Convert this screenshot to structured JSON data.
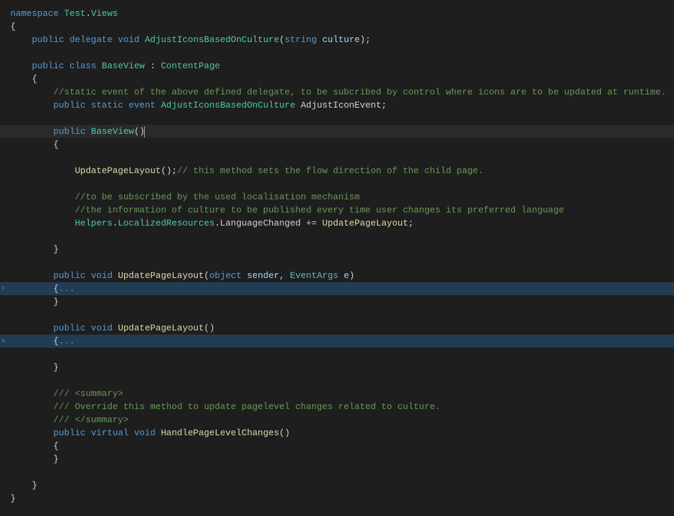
{
  "code": {
    "lines": [
      {
        "indent": 0,
        "segs": [
          [
            "kw",
            "namespace"
          ],
          [
            "str",
            " "
          ],
          [
            "cls",
            "Test"
          ],
          [
            "punc",
            "."
          ],
          [
            "cls",
            "Views"
          ]
        ]
      },
      {
        "indent": 0,
        "segs": [
          [
            "punc",
            "{"
          ]
        ]
      },
      {
        "indent": 1,
        "segs": [
          [
            "kw",
            "public"
          ],
          [
            "str",
            " "
          ],
          [
            "kw",
            "delegate"
          ],
          [
            "str",
            " "
          ],
          [
            "kw",
            "void"
          ],
          [
            "str",
            " "
          ],
          [
            "cls",
            "AdjustIconsBasedOnCulture"
          ],
          [
            "punc",
            "("
          ],
          [
            "kw",
            "string"
          ],
          [
            "str",
            " "
          ],
          [
            "param",
            "culture"
          ],
          [
            "punc",
            ");"
          ]
        ]
      },
      {
        "indent": 0,
        "segs": []
      },
      {
        "indent": 1,
        "segs": [
          [
            "kw",
            "public"
          ],
          [
            "str",
            " "
          ],
          [
            "kw",
            "class"
          ],
          [
            "str",
            " "
          ],
          [
            "cls",
            "BaseView"
          ],
          [
            "str",
            " : "
          ],
          [
            "cls",
            "ContentPage"
          ]
        ]
      },
      {
        "indent": 1,
        "segs": [
          [
            "punc",
            "{"
          ]
        ]
      },
      {
        "indent": 2,
        "segs": [
          [
            "cmt",
            "//static event of the above defined delegate, to be subcribed by control where icons are to be updated at runtime."
          ]
        ]
      },
      {
        "indent": 2,
        "segs": [
          [
            "kw",
            "public"
          ],
          [
            "str",
            " "
          ],
          [
            "kw",
            "static"
          ],
          [
            "str",
            " "
          ],
          [
            "kw",
            "event"
          ],
          [
            "str",
            " "
          ],
          [
            "cls",
            "AdjustIconsBasedOnCulture"
          ],
          [
            "str",
            " AdjustIconEvent;"
          ]
        ]
      },
      {
        "indent": 0,
        "segs": []
      },
      {
        "indent": 2,
        "current": true,
        "segs": [
          [
            "kw",
            "public"
          ],
          [
            "str",
            " "
          ],
          [
            "cls",
            "BaseView"
          ],
          [
            "punc",
            "()"
          ],
          [
            "cursor",
            ""
          ]
        ]
      },
      {
        "indent": 2,
        "segs": [
          [
            "punc",
            "{"
          ]
        ]
      },
      {
        "indent": 0,
        "segs": []
      },
      {
        "indent": 3,
        "segs": [
          [
            "mtd",
            "UpdatePageLayout"
          ],
          [
            "punc",
            "();"
          ],
          [
            "cmt",
            "// this method sets the flow direction of the child page."
          ]
        ]
      },
      {
        "indent": 0,
        "segs": []
      },
      {
        "indent": 3,
        "segs": [
          [
            "cmt",
            "//to be subscribed by the used localisation mechanism"
          ]
        ]
      },
      {
        "indent": 3,
        "segs": [
          [
            "cmt",
            "//the information of culture to be published every time user changes its preferred language"
          ]
        ]
      },
      {
        "indent": 3,
        "segs": [
          [
            "cls",
            "Helpers"
          ],
          [
            "punc",
            "."
          ],
          [
            "cls",
            "LocalizedResources"
          ],
          [
            "punc",
            "."
          ],
          [
            "str",
            "LanguageChanged "
          ],
          [
            "punc",
            "+="
          ],
          [
            "str",
            " "
          ],
          [
            "mtd",
            "UpdatePageLayout"
          ],
          [
            "punc",
            ";"
          ]
        ]
      },
      {
        "indent": 0,
        "segs": []
      },
      {
        "indent": 2,
        "segs": [
          [
            "punc",
            "}"
          ]
        ]
      },
      {
        "indent": 0,
        "segs": []
      },
      {
        "indent": 2,
        "segs": [
          [
            "kw",
            "public"
          ],
          [
            "str",
            " "
          ],
          [
            "kw",
            "void"
          ],
          [
            "str",
            " "
          ],
          [
            "mtd",
            "UpdatePageLayout"
          ],
          [
            "punc",
            "("
          ],
          [
            "kw",
            "object"
          ],
          [
            "str",
            " "
          ],
          [
            "param",
            "sender"
          ],
          [
            "punc",
            ", "
          ],
          [
            "cls",
            "EventArgs"
          ],
          [
            "str",
            " "
          ],
          [
            "param",
            "e"
          ],
          [
            "punc",
            ")"
          ]
        ]
      },
      {
        "indent": 2,
        "fold": true,
        "highlight": true,
        "segs": [
          [
            "punc",
            "{"
          ],
          [
            "fold-dots",
            "..."
          ]
        ]
      },
      {
        "indent": 2,
        "segs": [
          [
            "punc",
            "}"
          ]
        ]
      },
      {
        "indent": 0,
        "segs": []
      },
      {
        "indent": 2,
        "segs": [
          [
            "kw",
            "public"
          ],
          [
            "str",
            " "
          ],
          [
            "kw",
            "void"
          ],
          [
            "str",
            " "
          ],
          [
            "mtd",
            "UpdatePageLayout"
          ],
          [
            "punc",
            "()"
          ]
        ]
      },
      {
        "indent": 2,
        "fold": true,
        "highlight": true,
        "segs": [
          [
            "punc",
            "{"
          ],
          [
            "fold-dots",
            "..."
          ]
        ]
      },
      {
        "indent": 0,
        "segs": []
      },
      {
        "indent": 2,
        "segs": [
          [
            "punc",
            "}"
          ]
        ]
      },
      {
        "indent": 0,
        "segs": []
      },
      {
        "indent": 2,
        "segs": [
          [
            "cmt",
            "/// <summary>"
          ]
        ]
      },
      {
        "indent": 2,
        "segs": [
          [
            "cmt",
            "/// Override this method to update pagelevel changes related to culture."
          ]
        ]
      },
      {
        "indent": 2,
        "segs": [
          [
            "cmt",
            "/// </summary>"
          ]
        ]
      },
      {
        "indent": 2,
        "segs": [
          [
            "kw",
            "public"
          ],
          [
            "str",
            " "
          ],
          [
            "kw",
            "virtual"
          ],
          [
            "str",
            " "
          ],
          [
            "kw",
            "void"
          ],
          [
            "str",
            " "
          ],
          [
            "mtd",
            "HandlePageLevelChanges"
          ],
          [
            "punc",
            "()"
          ]
        ]
      },
      {
        "indent": 2,
        "segs": [
          [
            "punc",
            "{"
          ]
        ]
      },
      {
        "indent": 2,
        "segs": [
          [
            "punc",
            "}"
          ]
        ]
      },
      {
        "indent": 0,
        "segs": []
      },
      {
        "indent": 1,
        "segs": [
          [
            "punc",
            "}"
          ]
        ]
      },
      {
        "indent": 0,
        "segs": [
          [
            "punc",
            "}"
          ]
        ]
      }
    ]
  },
  "folds": [
    21,
    25
  ]
}
